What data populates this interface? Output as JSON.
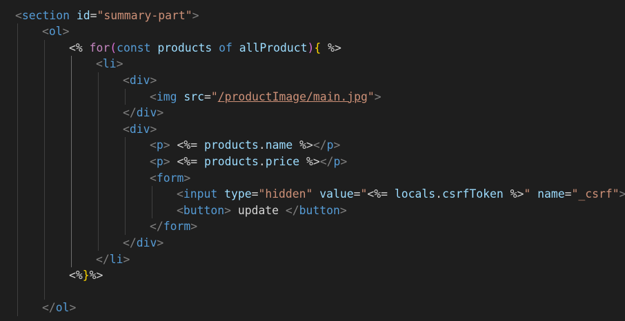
{
  "editor": {
    "lines": [
      {
        "indent": 0,
        "tokens": [
          {
            "c": "br",
            "t": "<"
          },
          {
            "c": "tag",
            "t": "section"
          },
          {
            "c": "text",
            "t": " "
          },
          {
            "c": "attr",
            "t": "id"
          },
          {
            "c": "text",
            "t": "="
          },
          {
            "c": "str",
            "t": "\"summary-part\""
          },
          {
            "c": "br",
            "t": ">"
          }
        ]
      },
      {
        "indent": 1,
        "tokens": [
          {
            "c": "br",
            "t": "<"
          },
          {
            "c": "tag",
            "t": "ol"
          },
          {
            "c": "br",
            "t": ">"
          }
        ]
      },
      {
        "indent": 2,
        "tokens": [
          {
            "c": "text",
            "t": "<% "
          },
          {
            "c": "ctrl",
            "t": "for"
          },
          {
            "c": "paren1",
            "t": "("
          },
          {
            "c": "kw",
            "t": "const"
          },
          {
            "c": "text",
            "t": " "
          },
          {
            "c": "var",
            "t": "products"
          },
          {
            "c": "text",
            "t": " "
          },
          {
            "c": "kw",
            "t": "of"
          },
          {
            "c": "text",
            "t": " "
          },
          {
            "c": "var",
            "t": "allProduct"
          },
          {
            "c": "paren1",
            "t": ")"
          },
          {
            "c": "brace",
            "t": "{"
          },
          {
            "c": "text",
            "t": " %>"
          }
        ]
      },
      {
        "indent": 3,
        "tokens": [
          {
            "c": "br",
            "t": "<"
          },
          {
            "c": "tag",
            "t": "li"
          },
          {
            "c": "br",
            "t": ">"
          }
        ]
      },
      {
        "indent": 4,
        "tokens": [
          {
            "c": "br",
            "t": "<"
          },
          {
            "c": "tag",
            "t": "div"
          },
          {
            "c": "br",
            "t": ">"
          }
        ]
      },
      {
        "indent": 5,
        "tokens": [
          {
            "c": "br",
            "t": "<"
          },
          {
            "c": "tag",
            "t": "img"
          },
          {
            "c": "text",
            "t": " "
          },
          {
            "c": "attr",
            "t": "src"
          },
          {
            "c": "text",
            "t": "="
          },
          {
            "c": "str",
            "t": "\""
          },
          {
            "c": "link",
            "t": "/productImage/main.jpg"
          },
          {
            "c": "str",
            "t": "\""
          },
          {
            "c": "br",
            "t": ">"
          }
        ]
      },
      {
        "indent": 4,
        "tokens": [
          {
            "c": "br",
            "t": "</"
          },
          {
            "c": "tag",
            "t": "div"
          },
          {
            "c": "br",
            "t": ">"
          }
        ]
      },
      {
        "indent": 4,
        "tokens": [
          {
            "c": "br",
            "t": "<"
          },
          {
            "c": "tag",
            "t": "div"
          },
          {
            "c": "br",
            "t": ">"
          }
        ]
      },
      {
        "indent": 5,
        "tokens": [
          {
            "c": "br",
            "t": "<"
          },
          {
            "c": "tag",
            "t": "p"
          },
          {
            "c": "br",
            "t": ">"
          },
          {
            "c": "text",
            "t": " <%= "
          },
          {
            "c": "var",
            "t": "products"
          },
          {
            "c": "text",
            "t": "."
          },
          {
            "c": "var",
            "t": "name"
          },
          {
            "c": "text",
            "t": " %>"
          },
          {
            "c": "br",
            "t": "</"
          },
          {
            "c": "tag",
            "t": "p"
          },
          {
            "c": "br",
            "t": ">"
          }
        ]
      },
      {
        "indent": 5,
        "tokens": [
          {
            "c": "br",
            "t": "<"
          },
          {
            "c": "tag",
            "t": "p"
          },
          {
            "c": "br",
            "t": ">"
          },
          {
            "c": "text",
            "t": " <%= "
          },
          {
            "c": "var",
            "t": "products"
          },
          {
            "c": "text",
            "t": "."
          },
          {
            "c": "var",
            "t": "price"
          },
          {
            "c": "text",
            "t": " %>"
          },
          {
            "c": "br",
            "t": "</"
          },
          {
            "c": "tag",
            "t": "p"
          },
          {
            "c": "br",
            "t": ">"
          }
        ]
      },
      {
        "indent": 5,
        "tokens": [
          {
            "c": "br",
            "t": "<"
          },
          {
            "c": "tag",
            "t": "form"
          },
          {
            "c": "br",
            "t": ">"
          }
        ]
      },
      {
        "indent": 6,
        "tokens": [
          {
            "c": "br",
            "t": "<"
          },
          {
            "c": "tag",
            "t": "input"
          },
          {
            "c": "text",
            "t": " "
          },
          {
            "c": "attr",
            "t": "type"
          },
          {
            "c": "text",
            "t": "="
          },
          {
            "c": "str",
            "t": "\"hidden\""
          },
          {
            "c": "text",
            "t": " "
          },
          {
            "c": "attr",
            "t": "value"
          },
          {
            "c": "text",
            "t": "="
          },
          {
            "c": "str",
            "t": "\""
          },
          {
            "c": "text",
            "t": "<%= "
          },
          {
            "c": "var",
            "t": "locals"
          },
          {
            "c": "text",
            "t": "."
          },
          {
            "c": "var",
            "t": "csrfToken"
          },
          {
            "c": "text",
            "t": " %>"
          },
          {
            "c": "str",
            "t": "\""
          },
          {
            "c": "text",
            "t": " "
          },
          {
            "c": "attr",
            "t": "name"
          },
          {
            "c": "text",
            "t": "="
          },
          {
            "c": "str",
            "t": "\"_csrf\""
          },
          {
            "c": "br",
            "t": ">"
          }
        ]
      },
      {
        "indent": 6,
        "tokens": [
          {
            "c": "br",
            "t": "<"
          },
          {
            "c": "tag",
            "t": "button"
          },
          {
            "c": "br",
            "t": ">"
          },
          {
            "c": "text",
            "t": " update "
          },
          {
            "c": "br",
            "t": "</"
          },
          {
            "c": "tag",
            "t": "button"
          },
          {
            "c": "br",
            "t": ">"
          }
        ]
      },
      {
        "indent": 5,
        "tokens": [
          {
            "c": "br",
            "t": "</"
          },
          {
            "c": "tag",
            "t": "form"
          },
          {
            "c": "br",
            "t": ">"
          }
        ]
      },
      {
        "indent": 4,
        "tokens": [
          {
            "c": "br",
            "t": "</"
          },
          {
            "c": "tag",
            "t": "div"
          },
          {
            "c": "br",
            "t": ">"
          }
        ]
      },
      {
        "indent": 3,
        "tokens": [
          {
            "c": "br",
            "t": "</"
          },
          {
            "c": "tag",
            "t": "li"
          },
          {
            "c": "br",
            "t": ">"
          }
        ]
      },
      {
        "indent": 2,
        "tokens": [
          {
            "c": "text",
            "t": "<%"
          },
          {
            "c": "brace",
            "t": "}"
          },
          {
            "c": "text",
            "t": "%>"
          }
        ]
      },
      {
        "indent": 2,
        "tokens": []
      },
      {
        "indent": 1,
        "tokens": [
          {
            "c": "br",
            "t": "</"
          },
          {
            "c": "tag",
            "t": "ol"
          },
          {
            "c": "br",
            "t": ">"
          }
        ]
      }
    ]
  },
  "colors": {
    "background": "#1e1e1e",
    "tag": "#569cd6",
    "bracket": "#808080",
    "attribute": "#9cdcfe",
    "string": "#ce9178",
    "control_keyword": "#c586c0",
    "brace": "#ffd700",
    "paren": "#da70d6",
    "text": "#d4d4d4"
  }
}
